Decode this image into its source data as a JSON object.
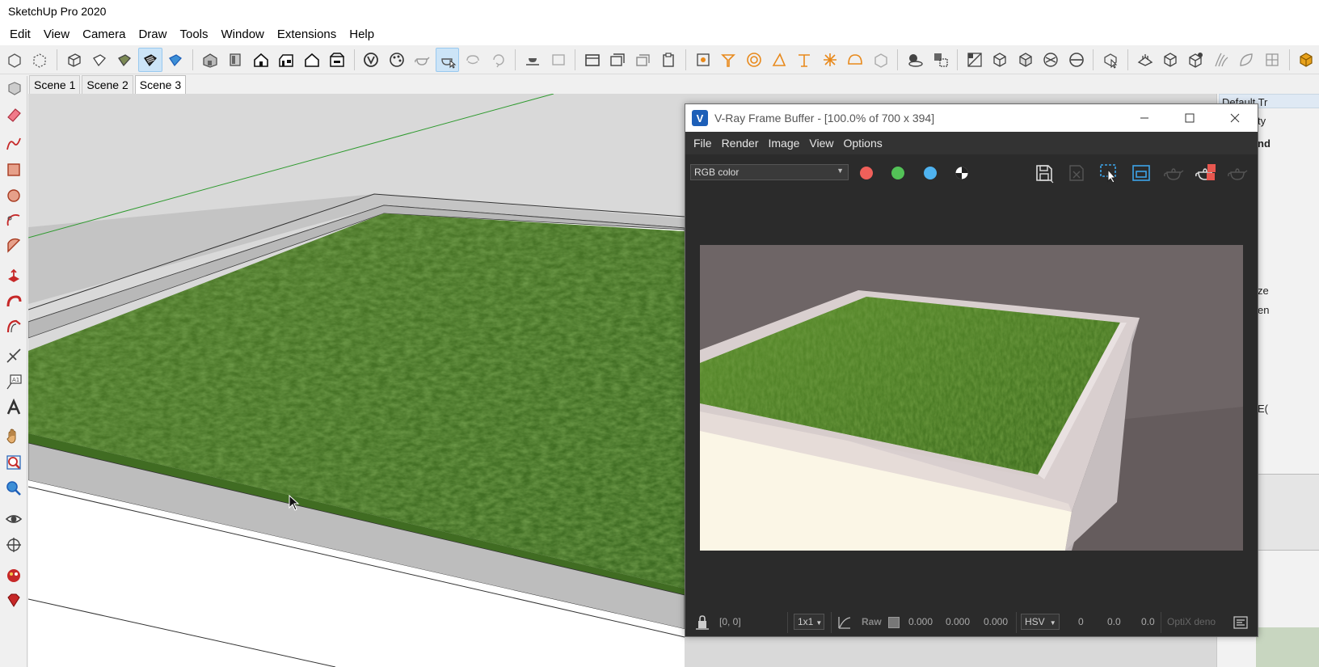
{
  "app": {
    "title": "SketchUp Pro 2020"
  },
  "menubar": {
    "items": [
      "Edit",
      "View",
      "Camera",
      "Draw",
      "Tools",
      "Window",
      "Extensions",
      "Help"
    ]
  },
  "scenes": {
    "tabs": [
      "Scene 1",
      "Scene 2",
      "Scene 3"
    ],
    "active": "Scene 3"
  },
  "right_panel": {
    "title_fragment": "Default Tr",
    "snippets": [
      "ty",
      "nd",
      "ze",
      "en",
      "E("
    ]
  },
  "vfb": {
    "logo": "V",
    "title": "V-Ray Frame Buffer - [100.0% of 700 x 394]",
    "menu": [
      "File",
      "Render",
      "Image",
      "View",
      "Options"
    ],
    "channel_select": "RGB color",
    "channel_colors": [
      "#f0605a",
      "#53c257",
      "#4fb3f0"
    ],
    "status": {
      "coords": "[0, 0]",
      "sampling": "1x1",
      "raw_label": "Raw",
      "rgb_values": [
        "0.000",
        "0.000",
        "0.000"
      ],
      "color_mode": "HSV",
      "hsv_values": [
        "0",
        "0.0",
        "0.0"
      ],
      "denoiser": "OptiX deno"
    }
  }
}
